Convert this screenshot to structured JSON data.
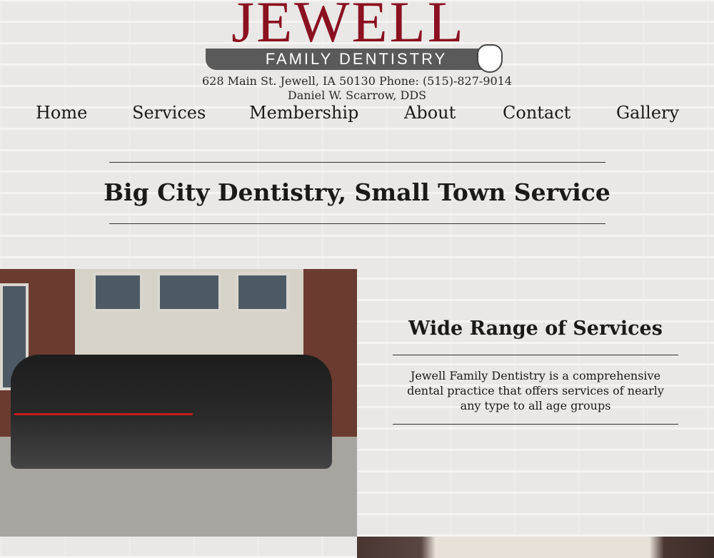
{
  "header": {
    "logo_main": "JEWELL",
    "logo_sub": "FAMILY DENTISTRY",
    "address_line": "628 Main St. Jewell, IA 50130 Phone: (515)-827-9014",
    "doctor_line": "Daniel W. Scarrow, DDS"
  },
  "nav": {
    "items": [
      {
        "label": "Home"
      },
      {
        "label": "Services"
      },
      {
        "label": "Membership"
      },
      {
        "label": "About"
      },
      {
        "label": "Contact"
      },
      {
        "label": "Gallery"
      }
    ]
  },
  "hero": {
    "tagline": "Big City Dentistry, Small Town Service"
  },
  "services": {
    "title": "Wide Range of Services",
    "description": "Jewell Family Dentistry is a comprehensive dental practice that offers services of nearly any type to all age groups"
  },
  "colors": {
    "brand_red": "#8b1020",
    "logo_gray": "#5a5a5a",
    "text": "#1a1a1a"
  }
}
